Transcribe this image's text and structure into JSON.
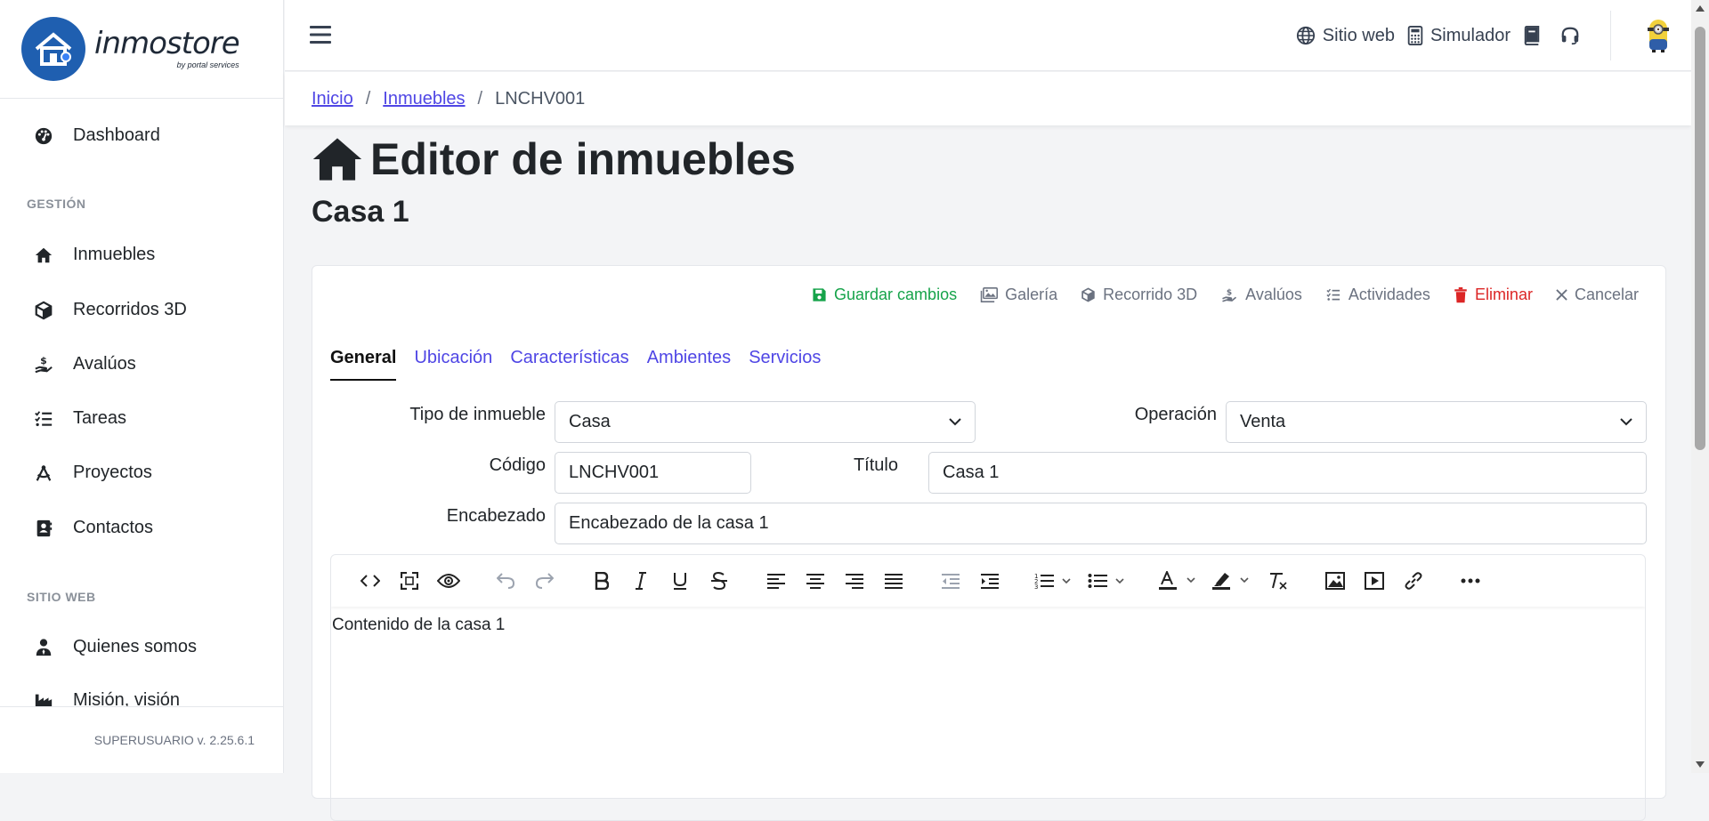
{
  "app": {
    "logo_text": "inmostore",
    "logo_sub": "by portal services",
    "version": "SUPERUSUARIO v. 2.25.6.1"
  },
  "sidebar": {
    "items": [
      {
        "label": "Dashboard",
        "icon": "dashboard-icon"
      },
      {
        "label": "Inmuebles",
        "icon": "home-icon"
      },
      {
        "label": "Recorridos 3D",
        "icon": "cube-icon"
      },
      {
        "label": "Avalúos",
        "icon": "hand-dollar-icon"
      },
      {
        "label": "Tareas",
        "icon": "list-check-icon"
      },
      {
        "label": "Proyectos",
        "icon": "compass-icon"
      },
      {
        "label": "Contactos",
        "icon": "address-book-icon"
      },
      {
        "label": "Quienes somos",
        "icon": "user-tie-icon"
      },
      {
        "label": "Misión, visión",
        "icon": "industry-icon"
      }
    ],
    "sections": {
      "gestion": "GESTIÓN",
      "sitio_web": "SITIO WEB"
    }
  },
  "topbar": {
    "links": [
      {
        "label": "Sitio web",
        "icon": "globe-icon"
      },
      {
        "label": "Simulador",
        "icon": "calculator-icon"
      }
    ]
  },
  "breadcrumb": {
    "home": "Inicio",
    "section": "Inmuebles",
    "current": "LNCHV001"
  },
  "page": {
    "title": "Editor de inmuebles",
    "subtitle": "Casa 1"
  },
  "actions": [
    {
      "label": "Guardar cambios",
      "color": "#16a34a"
    },
    {
      "label": "Galería",
      "color": "#6b7280"
    },
    {
      "label": "Recorrido 3D",
      "color": "#6b7280"
    },
    {
      "label": "Avalúos",
      "color": "#6b7280"
    },
    {
      "label": "Actividades",
      "color": "#6b7280"
    },
    {
      "label": "Eliminar",
      "color": "#dc2626"
    },
    {
      "label": "Cancelar",
      "color": "#6b7280"
    }
  ],
  "tabs": [
    "General",
    "Ubicación",
    "Características",
    "Ambientes",
    "Servicios"
  ],
  "form": {
    "tipo_label": "Tipo de inmueble",
    "tipo_value": "Casa",
    "operacion_label": "Operación",
    "operacion_value": "Venta",
    "codigo_label": "Código",
    "codigo_value": "LNCHV001",
    "titulo_label": "Título",
    "titulo_value": "Casa 1",
    "encabezado_label": "Encabezado",
    "encabezado_value": "Encabezado de la casa 1"
  },
  "editor": {
    "content": "Contenido de la casa 1"
  },
  "colors": {
    "accent": "#4f46e5",
    "success": "#16a34a",
    "danger": "#dc2626",
    "brand": "#1f5fb0"
  }
}
